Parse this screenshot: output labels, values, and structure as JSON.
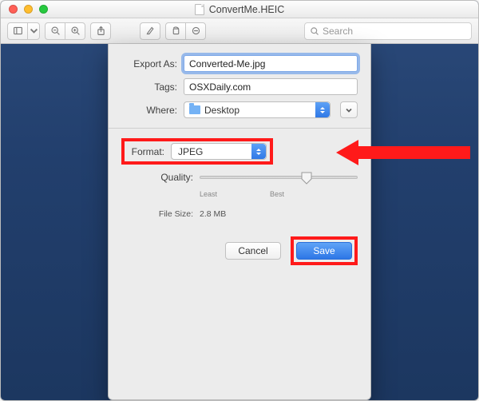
{
  "window": {
    "title": "ConvertMe.HEIC"
  },
  "toolbar": {
    "search_placeholder": "Search"
  },
  "sheet": {
    "export_as_label": "Export As:",
    "export_as_value": "Converted-Me.jpg",
    "tags_label": "Tags:",
    "tags_value": "OSXDaily.com",
    "where_label": "Where:",
    "where_value": "Desktop",
    "format_label": "Format:",
    "format_value": "JPEG",
    "quality_label": "Quality:",
    "quality_min": "Least",
    "quality_max": "Best",
    "filesize_label": "File Size:",
    "filesize_value": "2.8 MB",
    "cancel_label": "Cancel",
    "save_label": "Save"
  }
}
